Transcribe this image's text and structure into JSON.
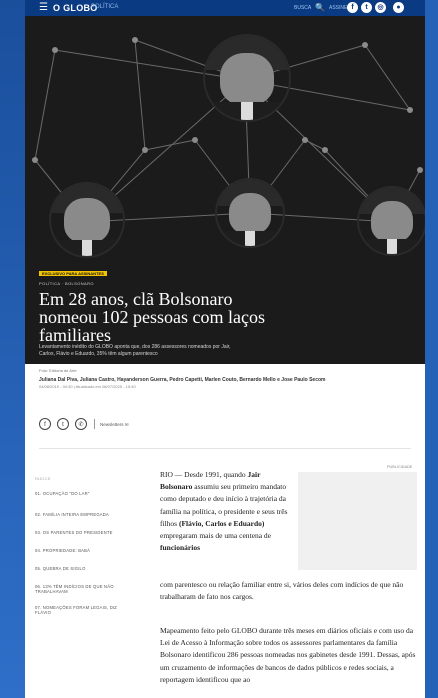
{
  "header": {
    "menu_glyph": "☰",
    "logo": "O GLOBO",
    "section": "POLÍTICA",
    "search_label": "BUSCA",
    "search_glyph": "🔍",
    "subscribe_label": "ASSINE",
    "social": [
      {
        "icon": "facebook-icon",
        "glyph": "f"
      },
      {
        "icon": "twitter-icon",
        "glyph": "t"
      },
      {
        "icon": "instagram-icon",
        "glyph": "◎"
      },
      {
        "icon": "user-icon",
        "glyph": "●"
      }
    ]
  },
  "hero": {
    "tag": "EXCLUSIVO PARA ASSINANTES",
    "kicker": "POLÍTICA · BOLSONARO",
    "headline": "Em 28 anos, clã Bolsonaro nomeou 102 pessoas com laços familiares",
    "subtitle": "Levantamento inédito do GLOBO aponta que, dos 286 assessores nomeados por Jair, Carlos, Flávio e Eduardo, 35% têm algum parentesco"
  },
  "meta": {
    "photo_credit": "Foto: Editoria de Arte",
    "authors": "Juliana Dal Piva, Juliana Castro, Hayanderson Guerra, Pedro Capetti, Marlen Couto, Bernardo Mello e Jose Paulo Secom",
    "dates": "04/08/2019 - 04:30 | Atualizado em 08/07/2020 - 15:40"
  },
  "share": {
    "buttons": [
      {
        "icon": "facebook-share-icon",
        "glyph": "f"
      },
      {
        "icon": "twitter-share-icon",
        "glyph": "t"
      },
      {
        "icon": "whatsapp-share-icon",
        "glyph": "✆"
      }
    ],
    "newsletter_label": "Newsletters",
    "newsletter_glyph": "✉"
  },
  "toc": {
    "title": "ÍNDICE",
    "items": [
      "01. OCUPAÇÃO \"DO LAR\"",
      "02. FAMÍLIA INTEIRA EMPREGADA",
      "03. OS PARENTES DO PRESIDENTE",
      "04. PROPRIEDADE: BABÁ",
      "05. QUEBRA DE SIGILO",
      "06. 13% TÊM INDÍCIOS DE QUE NÃO TRABALHAVAM",
      "07. NOMEAÇÕES FORAM LEGAIS, DIZ FLÁVIO"
    ]
  },
  "ad": {
    "label": "PUBLICIDADE"
  },
  "article": {
    "p1_a": "RIO — Desde 1991, quando",
    "p1_b1": "Jair Bolsonaro",
    "p1_c": "assumiu seu primeiro mandato como deputado e deu início à trajetória da família na política, o presidente e seus três filhos",
    "p1_b2": "(Flávio, Carlos e Eduardo)",
    "p1_d": "empregaram mais de uma centena de",
    "p1_b3": "funcionários",
    "p1_e": "com parentesco ou relação familiar entre si, vários deles com indícios de que não trabalharam de fato nos cargos.",
    "p2": "Mapeamento feito pelo GLOBO durante três meses em diários oficiais e com uso da Lei de Acesso à Informação sobre todos os assessores parlamentares da família Bolsonaro identificou 286 pessoas nomeadas nos gabinetes desde 1991. Dessas, após um cruzamento de informações de bancos de dados públicos e redes sociais, a reportagem identificou que ao"
  },
  "colors": {
    "brand_blue": "#0a3b82",
    "background_blue": "#1e5fb4",
    "tag_yellow": "#f2c400"
  }
}
